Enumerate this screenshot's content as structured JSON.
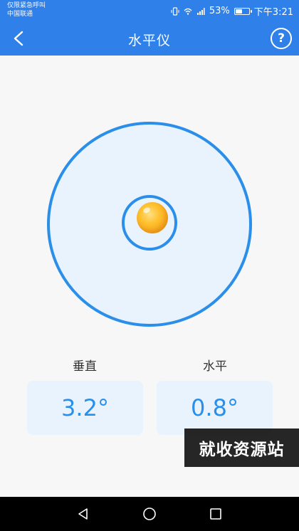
{
  "status_bar": {
    "carrier_line1": "仅限紧急呼叫",
    "carrier_line2": "中国联通",
    "battery_percent": "53%",
    "time": "下午3:21",
    "battery_level": 0.53
  },
  "header": {
    "title": "水平仪",
    "back_icon": "chevron-left-icon",
    "help_label": "?"
  },
  "level": {
    "vertical_label": "垂直",
    "horizontal_label": "水平",
    "vertical_value": "3.2°",
    "horizontal_value": "0.8°"
  },
  "watermark": {
    "text": "就收资源站"
  },
  "nav_bar": {
    "back_icon": "triangle-back-icon",
    "home_icon": "circle-home-icon",
    "recents_icon": "square-recents-icon"
  },
  "colors": {
    "primary": "#2f80e9",
    "accent_blue": "#2b8fea",
    "panel_bg": "#e8f3fd",
    "bubble": "#f7a21a"
  }
}
